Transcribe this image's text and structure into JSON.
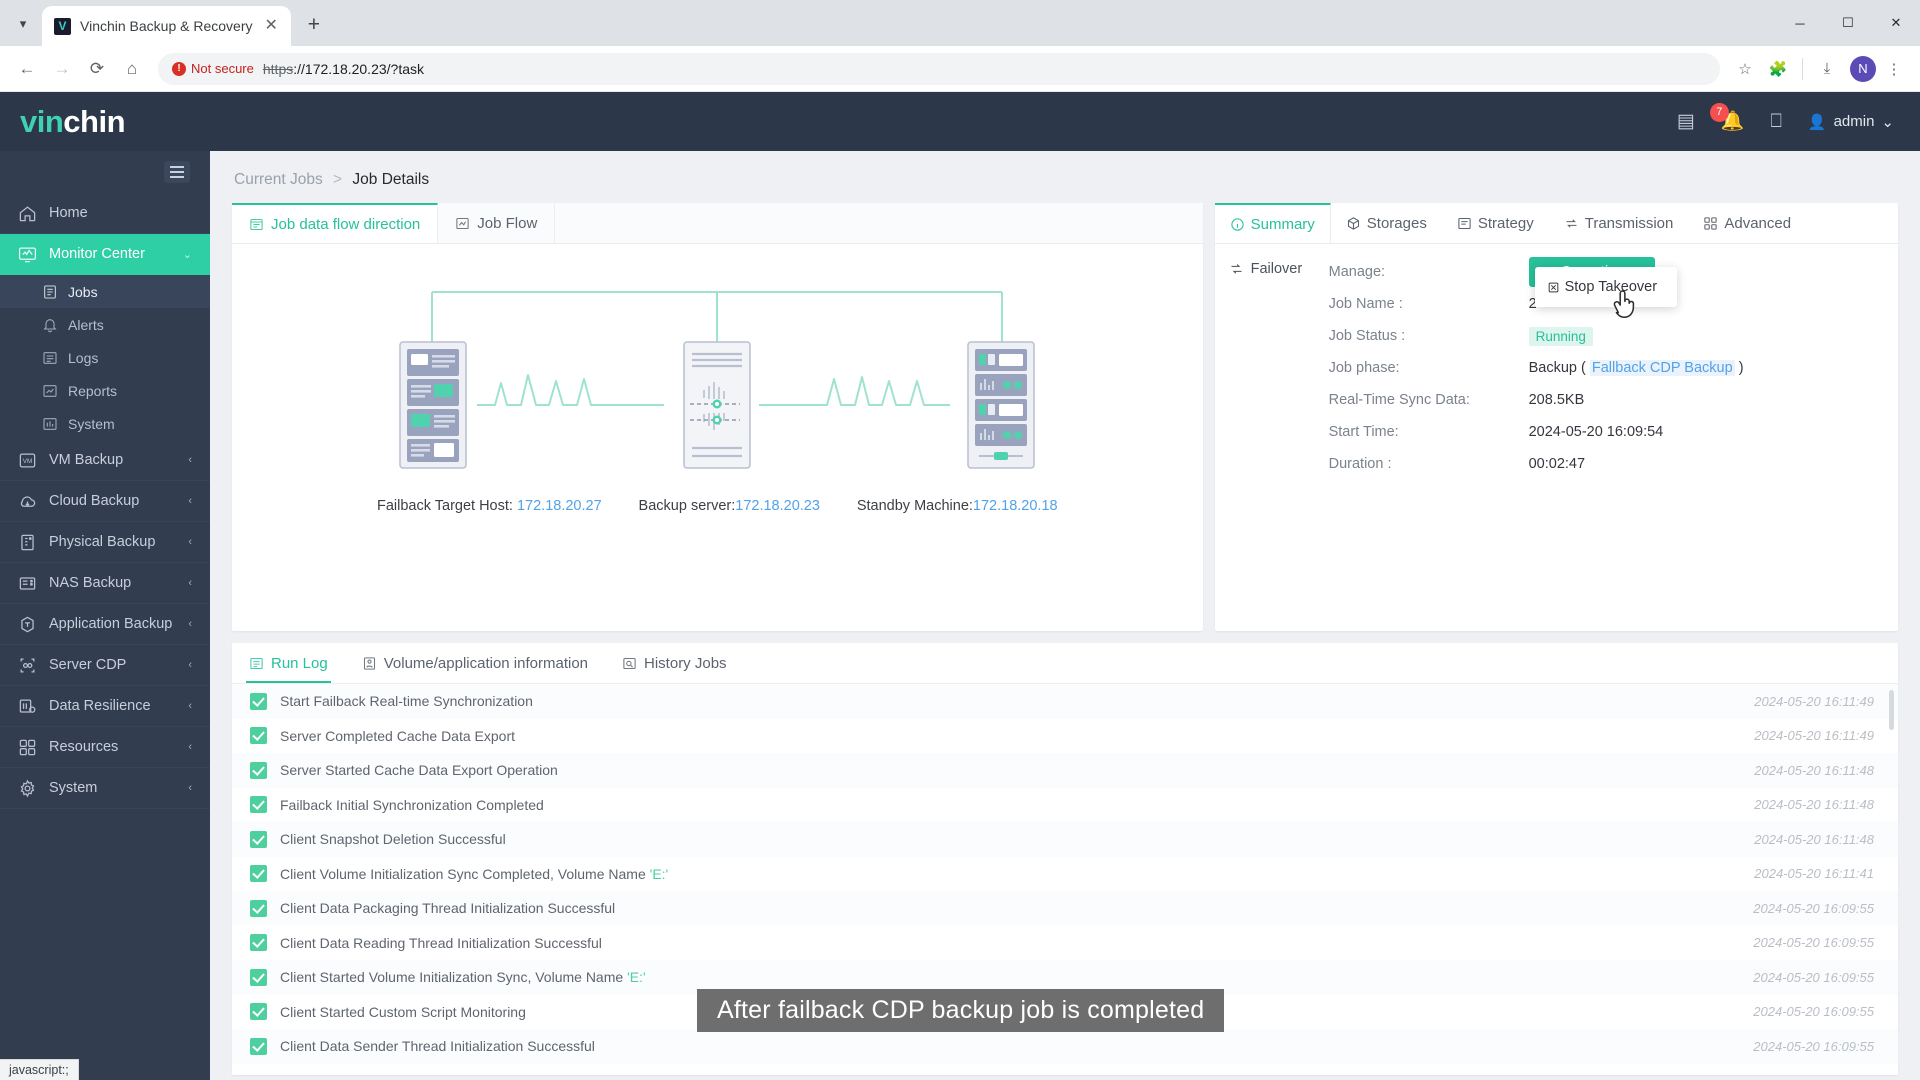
{
  "browser": {
    "tab": {
      "title": "Vinchin Backup & Recovery",
      "favicon_letter": "V",
      "close_label": "✕"
    },
    "tab_list_icon": "chevron-down-icon",
    "new_tab_label": "+",
    "window_controls": {
      "minimize": "─",
      "maximize": "☐",
      "close": "✕"
    },
    "toolbar": {
      "back": "←",
      "forward": "→",
      "reload": "⟳",
      "home": "⌂",
      "security_label": "Not secure",
      "url_scheme": "https",
      "url_rest": "://172.18.20.23/?task",
      "bookmark_icon": "star-icon",
      "extensions_icon": "puzzle-icon",
      "download_icon": "download-icon",
      "profile_letter": "N",
      "menu_icon": "kebab-menu-icon"
    },
    "status_bubble": "javascript:;"
  },
  "app_header": {
    "logo_part1": "vin",
    "logo_part2": "chin",
    "icons": [
      {
        "name": "document-icon",
        "glyph": "▤"
      },
      {
        "name": "bell-icon",
        "glyph": "⬡",
        "badge": "7"
      },
      {
        "name": "monitor-icon",
        "glyph": "⎕"
      }
    ],
    "user": "admin",
    "user_caret": "⌄"
  },
  "sidebar": {
    "items": [
      {
        "label": "Home",
        "icon": "home-icon",
        "active": false,
        "has_chevron": false
      },
      {
        "label": "Monitor Center",
        "icon": "monitor-center-icon",
        "active": true,
        "has_chevron": true,
        "chevron": "⌄"
      },
      {
        "label": "VM Backup",
        "icon": "vm-icon",
        "active": false,
        "has_chevron": true,
        "chevron": "‹"
      },
      {
        "label": "Cloud Backup",
        "icon": "cloud-icon",
        "active": false,
        "has_chevron": true,
        "chevron": "‹"
      },
      {
        "label": "Physical Backup",
        "icon": "server-icon",
        "active": false,
        "has_chevron": true,
        "chevron": "‹"
      },
      {
        "label": "NAS Backup",
        "icon": "nas-icon",
        "active": false,
        "has_chevron": true,
        "chevron": "‹"
      },
      {
        "label": "Application Backup",
        "icon": "app-icon",
        "active": false,
        "has_chevron": true,
        "chevron": "‹"
      },
      {
        "label": "Server CDP",
        "icon": "cdp-icon",
        "active": false,
        "has_chevron": true,
        "chevron": "‹"
      },
      {
        "label": "Data Resilience",
        "icon": "resilience-icon",
        "active": false,
        "has_chevron": true,
        "chevron": "‹"
      },
      {
        "label": "Resources",
        "icon": "resources-icon",
        "active": false,
        "has_chevron": true,
        "chevron": "‹"
      },
      {
        "label": "System",
        "icon": "gear-icon",
        "active": false,
        "has_chevron": true,
        "chevron": "‹"
      }
    ],
    "sub_items": [
      {
        "label": "Jobs",
        "icon": "jobs-icon",
        "selected": true
      },
      {
        "label": "Alerts",
        "icon": "alert-bell-icon",
        "selected": false
      },
      {
        "label": "Logs",
        "icon": "logs-icon",
        "selected": false
      },
      {
        "label": "Reports",
        "icon": "reports-icon",
        "selected": false
      },
      {
        "label": "System",
        "icon": "system-chart-icon",
        "selected": false
      }
    ]
  },
  "breadcrumb": {
    "parent": "Current Jobs",
    "separator": ">",
    "current": "Job Details"
  },
  "left_panel": {
    "tabs": [
      {
        "label": "Job data flow direction",
        "icon": "flow-icon",
        "active": true
      },
      {
        "label": "Job Flow",
        "icon": "chart-icon",
        "active": false
      }
    ],
    "diagram": {
      "nodes": [
        {
          "role": "Failback Target Host: ",
          "ip": "172.18.20.27",
          "name": "failback-target-host"
        },
        {
          "role": "Backup server:",
          "ip": "172.18.20.23",
          "name": "backup-server"
        },
        {
          "role": "Standby Machine:",
          "ip": "172.18.20.18",
          "name": "standby-machine"
        }
      ]
    }
  },
  "right_panel": {
    "tabs": [
      {
        "label": "Summary",
        "icon": "info-icon",
        "active": true
      },
      {
        "label": "Storages",
        "icon": "box-icon",
        "active": false
      },
      {
        "label": "Strategy",
        "icon": "strategy-icon",
        "active": false
      },
      {
        "label": "Transmission",
        "icon": "transmission-icon",
        "active": false
      },
      {
        "label": "Advanced",
        "icon": "advanced-icon",
        "active": false
      }
    ],
    "side_items": [
      {
        "label": "Failover",
        "icon": "failover-icon"
      }
    ],
    "fields": [
      {
        "label": "Manage:",
        "type": "button",
        "value": "Operation",
        "icon": "operation-icon",
        "caret": "⌄"
      },
      {
        "label": "Job Name :",
        "type": "text",
        "value": "2"
      },
      {
        "label": "Job Status :",
        "type": "pill",
        "value": "Running"
      },
      {
        "label": "Job phase:",
        "type": "phase",
        "value": "Backup",
        "paren_open": "(",
        "link": "Fallback CDP Backup",
        "paren_close": ")"
      },
      {
        "label": "Real-Time Sync Data:",
        "type": "text",
        "value": "208.5KB"
      },
      {
        "label": "Start Time:",
        "type": "text",
        "value": "2024-05-20 16:09:54"
      },
      {
        "label": "Duration :",
        "type": "text",
        "value": "00:02:47"
      }
    ],
    "dropdown": {
      "items": [
        {
          "label": "Stop Takeover",
          "icon": "stop-icon"
        }
      ]
    }
  },
  "bottom_panel": {
    "tabs": [
      {
        "label": "Run Log",
        "icon": "runlog-icon",
        "active": true
      },
      {
        "label": "Volume/application information",
        "icon": "volume-icon",
        "active": false
      },
      {
        "label": "History Jobs",
        "icon": "history-icon",
        "active": false
      }
    ],
    "logs": [
      {
        "status": "success",
        "message": "Start Failback Real-time Synchronization",
        "time": "2024-05-20 16:11:49"
      },
      {
        "status": "success",
        "message": "Server Completed Cache Data Export",
        "time": "2024-05-20 16:11:49"
      },
      {
        "status": "success",
        "message": "Server Started Cache Data Export Operation",
        "time": "2024-05-20 16:11:48"
      },
      {
        "status": "success",
        "message": "Failback Initial Synchronization Completed",
        "time": "2024-05-20 16:11:48"
      },
      {
        "status": "success",
        "message": "Client Snapshot Deletion Successful",
        "time": "2024-05-20 16:11:48"
      },
      {
        "status": "success",
        "message": "Client Volume Initialization Sync Completed, Volume Name 'E:'",
        "time": "2024-05-20 16:11:41"
      },
      {
        "status": "success",
        "message": "Client Data Packaging Thread Initialization Successful",
        "time": "2024-05-20 16:09:55"
      },
      {
        "status": "success",
        "message": "Client Data Reading Thread Initialization Successful",
        "time": "2024-05-20 16:09:55"
      },
      {
        "status": "success",
        "message": "Client Started Volume Initialization Sync, Volume Name 'E:'",
        "time": "2024-05-20 16:09:55"
      },
      {
        "status": "success",
        "message": "Client Started Custom Script Monitoring",
        "time": "2024-05-20 16:09:55"
      },
      {
        "status": "success",
        "message": "Client Data Sender Thread Initialization Successful",
        "time": "2024-05-20 16:09:55"
      }
    ]
  },
  "caption": "After failback CDP backup job is completed",
  "colors": {
    "accent": "#27c19a",
    "sidebar_bg": "#323d50",
    "header_bg": "#2c3849",
    "link": "#53a2e8",
    "badge": "#f5504f"
  }
}
